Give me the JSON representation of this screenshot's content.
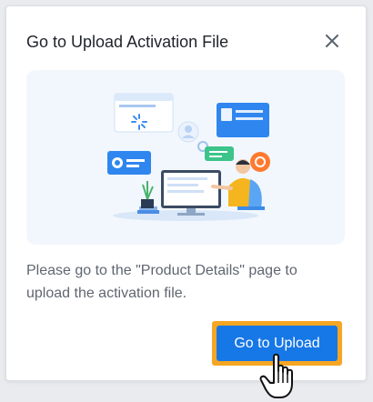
{
  "dialog": {
    "title": "Go to Upload Activation File",
    "close_icon": "close-icon",
    "illustration": "upload-activation-illustration",
    "message": "Please go to the \"Product Details\" page to upload the activation file.",
    "primary_button": "Go to Upload"
  },
  "pointer": "hand-pointer-icon",
  "colors": {
    "primary": "#1677e6",
    "highlight": "#f5a623",
    "illustration_bg": "#f2f7fd",
    "text_title": "#1f2329",
    "text_body": "#5f6670"
  }
}
